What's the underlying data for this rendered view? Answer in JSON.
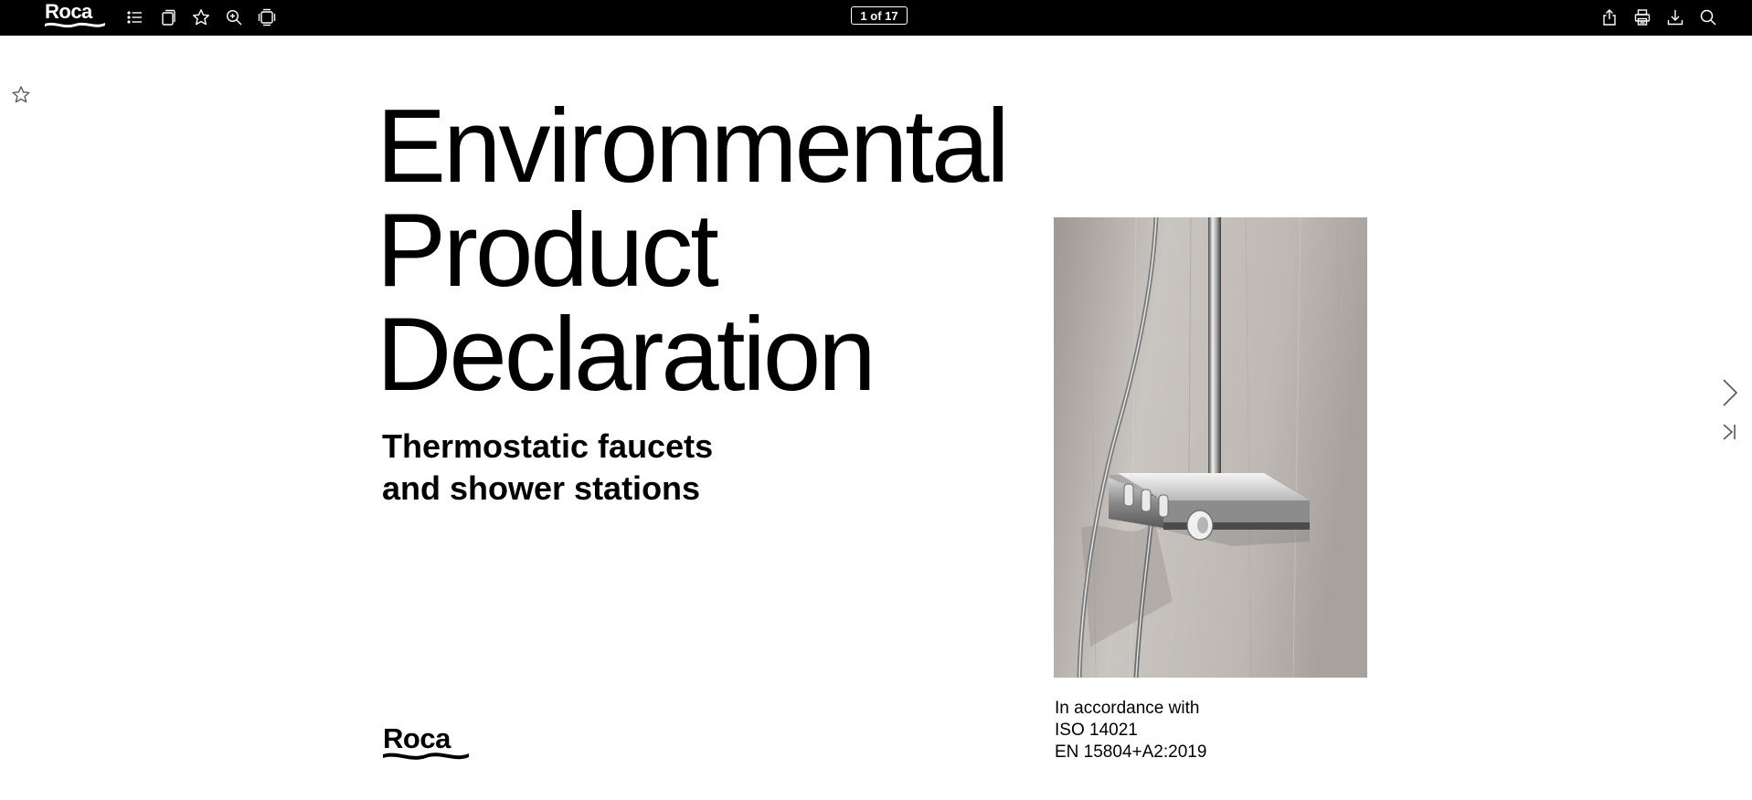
{
  "toolbar": {
    "logo": "Roca",
    "page_counter": "1 of 17",
    "left_icons": [
      "table-of-contents-icon",
      "pages-icon",
      "bookmark-star-icon",
      "zoom-icon",
      "fullscreen-icon"
    ],
    "right_icons": [
      "share-icon",
      "print-icon",
      "download-icon",
      "search-icon"
    ]
  },
  "page": {
    "title_lines": [
      "Environmental",
      "Product",
      "Declaration"
    ],
    "subtitle_lines": [
      "Thermostatic faucets",
      "and shower stations"
    ],
    "standards_lines": [
      "In accordance with",
      "ISO 14021",
      "EN 15804+A2:2019"
    ],
    "footer_logo": "Roca",
    "image": "thermostatic-shower-station-photo"
  },
  "navigation": {
    "next_icon": "chevron-right-icon",
    "last_icon": "last-page-icon"
  },
  "colors": {
    "toolbar_bg": "#000000",
    "page_bg": "#ffffff",
    "text": "#000000"
  }
}
